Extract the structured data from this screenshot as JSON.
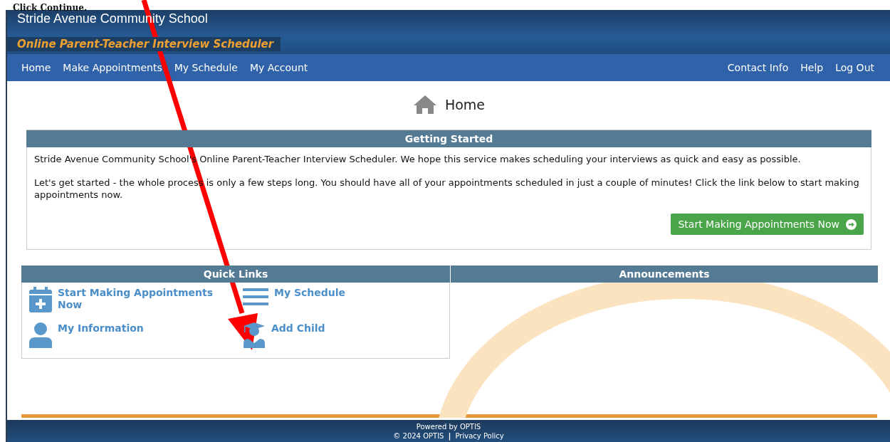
{
  "caption": "Click Continue.",
  "header": {
    "school": "Stride Avenue Community School",
    "subtitle": "Online Parent-Teacher Interview Scheduler"
  },
  "nav": {
    "left": [
      "Home",
      "Make Appointments",
      "My Schedule",
      "My Account"
    ],
    "right": [
      "Contact Info",
      "Help",
      "Log Out"
    ]
  },
  "page_title": "Home",
  "getting_started": {
    "title": "Getting Started",
    "paragraphs": [
      "Stride Avenue Community School's Online Parent-Teacher Interview Scheduler. We hope this service makes scheduling your interviews as quick and easy as possible.",
      "Let's get started - the whole process is only a few steps long. You should have all of your appointments scheduled in just a couple of minutes! Click the link below to start making appointments now."
    ],
    "button": "Start Making Appointments Now"
  },
  "quick_links": {
    "title": "Quick Links",
    "items": [
      {
        "kind": "calendar",
        "label": "Start Making Appointments Now"
      },
      {
        "kind": "list",
        "label": "My Schedule"
      },
      {
        "kind": "person",
        "label": "My Information"
      },
      {
        "kind": "graduate",
        "label": "Add Child"
      }
    ]
  },
  "announcements": {
    "title": "Announcements"
  },
  "footer": {
    "powered": "Powered by OPTIS",
    "copyright": "© 2024 OPTIS",
    "separator": "|",
    "privacy": "Privacy Policy"
  }
}
